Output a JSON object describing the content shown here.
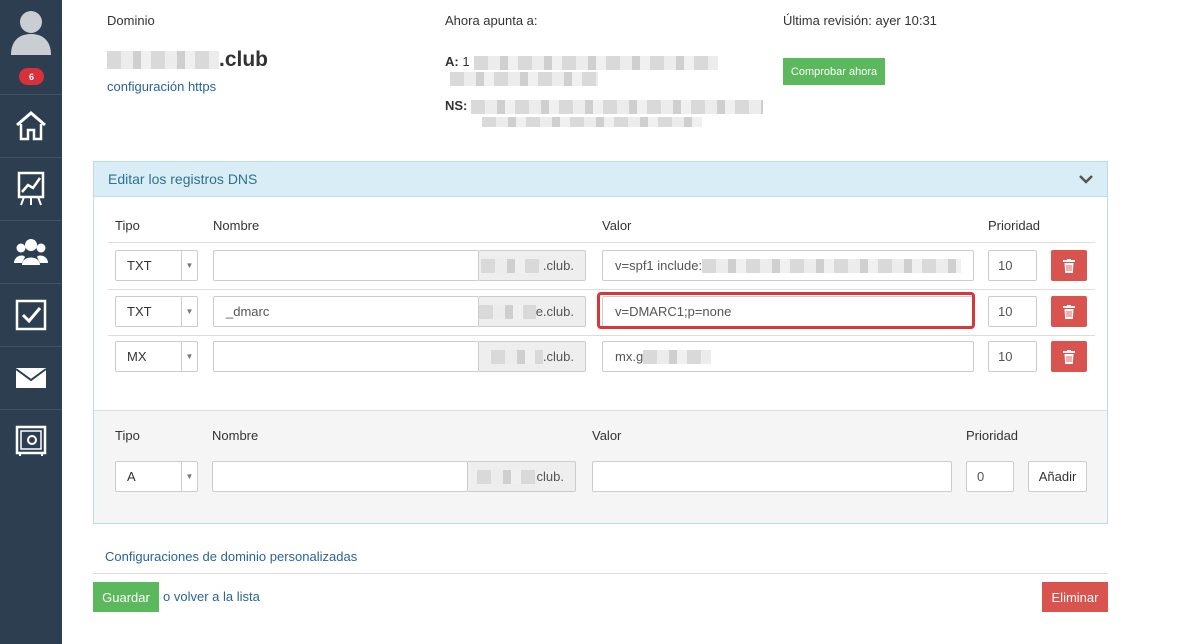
{
  "sidebar": {
    "notifications_count": "6",
    "items": [
      {
        "icon": "home-icon"
      },
      {
        "icon": "chart-icon"
      },
      {
        "icon": "users-icon"
      },
      {
        "icon": "checkbox-icon"
      },
      {
        "icon": "mail-icon"
      },
      {
        "icon": "safe-icon"
      }
    ]
  },
  "domain_info": {
    "domain_label": "Dominio",
    "domain_suffix": ".club",
    "https_link": "configuración https",
    "points_to_label": "Ahora apunta a:",
    "a_label": "A:",
    "a_value_visible": "1",
    "ns_label": "NS:",
    "last_review": "Última revisión: ayer 10:31",
    "check_now_button": "Comprobar ahora"
  },
  "dns_panel": {
    "title": "Editar los registros DNS",
    "columns": {
      "type": "Tipo",
      "name": "Nombre",
      "value": "Valor",
      "priority": "Prioridad"
    },
    "records": [
      {
        "type": "TXT",
        "name": "",
        "suffix": ".club.",
        "value": "v=spf1 include:",
        "priority": "10",
        "highlighted": false
      },
      {
        "type": "TXT",
        "name": "_dmarc",
        "suffix": "e.club.",
        "value": "v=DMARC1;p=none",
        "priority": "10",
        "highlighted": true
      },
      {
        "type": "MX",
        "name": "",
        "suffix": ".club.",
        "value": "mx.g",
        "priority": "10",
        "highlighted": false
      }
    ],
    "new_record": {
      "type": "A",
      "name": "",
      "suffix": "club.",
      "value": "",
      "priority": "0",
      "add_button": "Añadir"
    }
  },
  "footer": {
    "custom_config_link": "Configuraciones de dominio personalizadas",
    "save_button": "Guardar",
    "back_link": "o volver a la lista",
    "delete_button": "Eliminar"
  },
  "colors": {
    "sidebar": "#2c3e50",
    "badge": "#d9303a",
    "green": "#5cb85c",
    "danger": "#d9534f",
    "panel_head": "#d9edf7",
    "highlight": "#d9363a"
  }
}
